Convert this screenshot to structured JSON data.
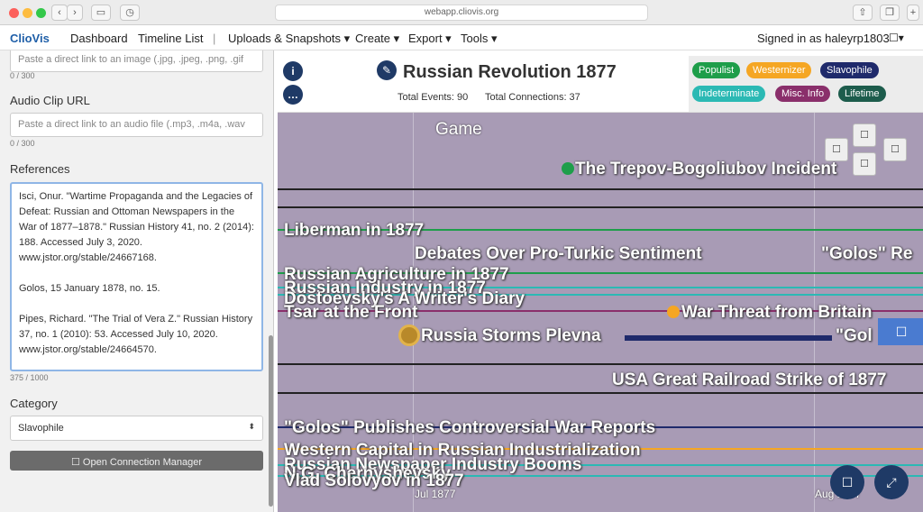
{
  "browser": {
    "url": "webapp.cliovis.org"
  },
  "nav": {
    "brand": "ClioVis",
    "dashboard": "Dashboard",
    "timeline_list": "Timeline List",
    "separator": "|",
    "uploads": "Uploads & Snapshots ▾",
    "create": "Create ▾",
    "export": "Export ▾",
    "tools": "Tools ▾",
    "signed_in": "Signed in as haleyrp1803"
  },
  "sidebar": {
    "image_placeholder": "Paste a direct link to an image (.jpg, .jpeg, .png, .gif",
    "image_count": "0 / 300",
    "audio_label": "Audio Clip URL",
    "audio_placeholder": "Paste a direct link to an audio file (.mp3, .m4a, .wav",
    "audio_count": "0 / 300",
    "references_label": "References",
    "references_value": "Isci, Onur. \"Wartime Propaganda and the Legacies of Defeat: Russian and Ottoman Newspapers in the War of 1877–1878.\" Russian History 41, no. 2 (2014): 188. Accessed July 3, 2020. www.jstor.org/stable/24667168.\n\nGolos, 15 January 1878, no. 15.\n\nPipes, Richard. \"The Trial of Vera Z.\" Russian History 37, no. 1 (2010): 53. Accessed July 10, 2020. www.jstor.org/stable/24664570.",
    "references_count": "375 / 1000",
    "category_label": "Category",
    "category_value": "Slavophile",
    "open_connection_manager": "Open Connection Manager"
  },
  "timeline": {
    "title": "Russian Revolution 1877",
    "total_events": "Total Events: 90",
    "total_connections": "Total Connections: 37",
    "categories": [
      {
        "label": "Populist",
        "bg": "#1e9e4a",
        "fg": "#ffffff"
      },
      {
        "label": "Westernizer",
        "bg": "#f5a623",
        "fg": "#ffffff"
      },
      {
        "label": "Slavophile",
        "bg": "#1f2a6b",
        "fg": "#ffffff"
      },
      {
        "label": "Indeterminate",
        "bg": "#2bb9b4",
        "fg": "#ffffff"
      },
      {
        "label": "Misc. Info",
        "bg": "#8a2f6b",
        "fg": "#ffffff"
      },
      {
        "label": "Lifetime",
        "bg": "#1d5c4c",
        "fg": "#ffffff"
      }
    ],
    "group_label": "Game",
    "events": [
      "The Trepov-Bogoliubov Incident",
      "Liberman in 1877",
      "Debates Over Pro-Turkic Sentiment",
      "\"Golos\" Re",
      "Russian Agriculture in 1877",
      "Russian Industry in 1877",
      "Dostoevsky's A Writer's Diary",
      "Tsar at the Front",
      "War Threat from Britain",
      "Russia Storms Plevna",
      "\"Gol",
      "USA Great Railroad Strike of 1877",
      "\"Golos\" Publishes Controversial War Reports",
      "Western Capital in Russian Industrialization",
      "Russian Newspaper Industry Booms",
      "N.G. Chernyshevsky",
      "Vlad Solovyov in 1877"
    ],
    "axis": [
      "Jul 1877",
      "Aug 1877"
    ]
  }
}
